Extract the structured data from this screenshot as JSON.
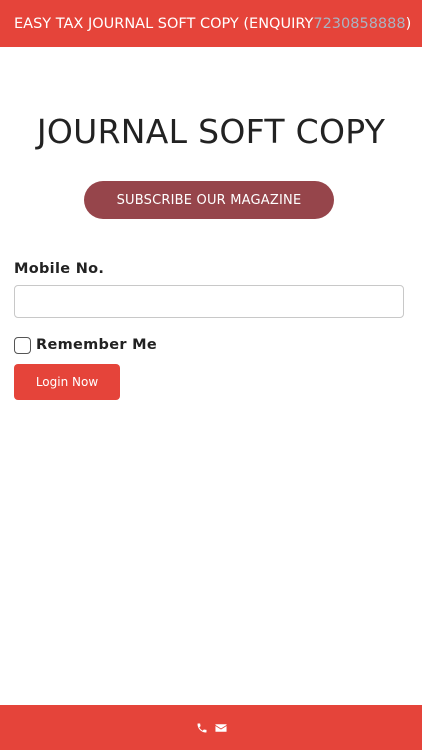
{
  "header": {
    "title_prefix": "EASY TAX JOURNAL SOFT COPY (ENQUIRY ",
    "phone": "7230858888",
    "title_suffix": ")"
  },
  "main": {
    "title": "JOURNAL SOFT COPY",
    "subscribe_label": "SUBSCRIBE OUR MAGAZINE"
  },
  "form": {
    "mobile_label": "Mobile No.",
    "mobile_value": "",
    "mobile_placeholder": "",
    "remember_label": "Remember Me",
    "remember_checked": false,
    "login_label": "Login Now"
  },
  "footer": {
    "icons": [
      "phone-icon",
      "envelope-icon"
    ]
  },
  "colors": {
    "accent": "#e5443a",
    "subscribe": "#96454b",
    "phone_link": "#a9b3c2"
  }
}
